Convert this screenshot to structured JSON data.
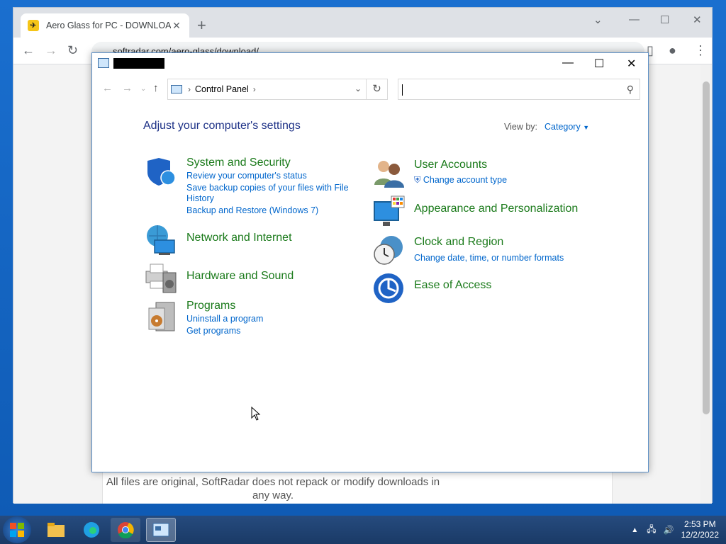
{
  "browser": {
    "tab_title": "Aero Glass for PC - DOWNLOAD",
    "tab_close": "✕",
    "new_tab": "+",
    "url": "softradar.com/aero-glass/download/",
    "page_notice": "All files are original, SoftRadar does not repack or modify downloads in any way."
  },
  "control_panel": {
    "address_crumb": "Control Panel",
    "search_placeholder": "",
    "heading": "Adjust your computer's settings",
    "view_by_label": "View by:",
    "view_by_value": "Category",
    "left_categories": [
      {
        "title": "System and Security",
        "icon": "shield-icon",
        "links": [
          "Review your computer's status",
          "Save backup copies of your files with File",
          "History",
          "Backup and Restore (Windows 7)"
        ]
      },
      {
        "title": "Network and Internet",
        "icon": "network-icon",
        "links": []
      },
      {
        "title": "Hardware and Sound",
        "icon": "printer-icon",
        "links": []
      },
      {
        "title": "Programs",
        "icon": "programs-icon",
        "links": [
          "Uninstall a program",
          "Get programs"
        ]
      }
    ],
    "right_categories": [
      {
        "title": "User Accounts",
        "icon": "users-icon",
        "links": [
          "Change account type"
        ]
      },
      {
        "title": "Appearance and Personalization",
        "icon": "monitor-icon",
        "links": []
      },
      {
        "title": "Clock and Region",
        "icon": "clock-icon",
        "links": [
          "Change date, time, or number formats"
        ]
      },
      {
        "title": "Ease of Access",
        "icon": "ease-of-access-icon",
        "links": []
      }
    ]
  },
  "taskbar": {
    "time": "2:53 PM",
    "date": "12/2/2022",
    "items": [
      "start-button",
      "file-explorer-icon",
      "edge-icon",
      "chrome-icon",
      "control-panel-icon"
    ]
  },
  "colors": {
    "category_title": "#1a7a1a",
    "link": "#0066cc",
    "heading": "#1e3287",
    "desktop": "#1565c0"
  }
}
